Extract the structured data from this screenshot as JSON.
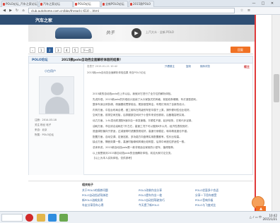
{
  "browser": {
    "tabs": [
      {
        "label": "POLO论坛_汽车之家论坛"
      },
      {
        "label": "汽车之家论坛"
      },
      {
        "label": "POLO论坛"
      },
      {
        "label": "全新POLO论坛"
      },
      {
        "label": "2015款POLO"
      }
    ],
    "window_controls": [
      "—",
      "□",
      "✕"
    ],
    "url": "club.autohome.com.cn/bbs/thread-c-614-...html"
  },
  "site": {
    "logo": "汽车之家",
    "banner_logo": "执手",
    "banner_text": "上汽大众 · 全新 POLO"
  },
  "pager": {
    "pages": [
      "1",
      "2",
      "3",
      "4",
      "5"
    ],
    "next_label": "下一页",
    "reply_label": "回复"
  },
  "thread": {
    "forum_name": "POLO论坛",
    "title": "2015款polo自动挡全面解析体验的结果！"
  },
  "post": {
    "author": "小白用户",
    "author_info": [
      "注册：2014-03-18",
      "关注 粉丝 帖子",
      "来自：北京",
      "所属：POLO论坛"
    ],
    "meta": "发表于 2015-01-21 10:42",
    "links": [
      "只看楼主",
      "复制",
      "倒序浏览"
    ],
    "floor": "楼主",
    "summary": "2015款polo自动挡全面解析体验结果 来自POLO论坛",
    "body_lines": [
      "2015款的自动挡polo在上市以后，我就对它进行了全方位的解析体验。",
      "先说外观，2015款polo的外观设计延续了大众家族式的风格，前脸线条硬朗，车灯造型锐利。",
      "整体车身比例协调，侧面腰线贯穿前后，尾部造型简洁，车尾灯采用了全新的设计。",
      "内饰方面，中控台布局合理，做工用料在同级别车型中属于上乘，操作便利性也比较好。",
      "空间方面，前排空间充裕，后排腿部空间对于小型车来说也够用，后备箱容积实用。",
      "动力方面，1.6L发动机搭配6速手自一体变速箱，平顺性不错，起步轻快，日常代步足够。",
      "油耗方面，市区综合油耗在7升左右，高速工况下可以做到6升以内，经济性表现良好。",
      "底盘调校偏向于舒适，过减速带时滤震表现较好，高速行驶稳定，转向精准度也不错。",
      "配置方面，自动空调、定速巡航、多功能方向盘等实用配置都有，性价比较高。",
      "缺点方面，隔音效果一般，高速时胎噪和风噪比较明显，后排中间座位舒适性一般。",
      "总体来说，2015款自动挡polo是一款非常适合家用的小型车，值得推荐。",
      "以上就是我对2015款自动挡polo的全面解析体验，欢迎大家讨论交流。",
      "【以上为本人实际体验，仅供参考】"
    ]
  },
  "related": {
    "heading": "相关帖子",
    "items": [
      "关于POLO的保养问题",
      "POLO自动挡试驾体验",
      "新POLO油耗实测",
      "车友分享用车心得",
      "POLO改装作业分享",
      "POLO提车作业一枚",
      "POLO自动挡驾驶技巧",
      "今天提了新POLO",
      "POLO优惠多少合适",
      "分享一下用车感受",
      "POLO音响升级",
      "POLO与飞度对比"
    ]
  },
  "taskbar": {
    "sys_icons": "△ ♪ ▭ 中",
    "time": "10:42",
    "date": "2015/1/21"
  },
  "colors": {
    "header": "#2f4f74",
    "accent": "#f07124",
    "link": "#2f5f99",
    "frame": "#e03a3a"
  }
}
